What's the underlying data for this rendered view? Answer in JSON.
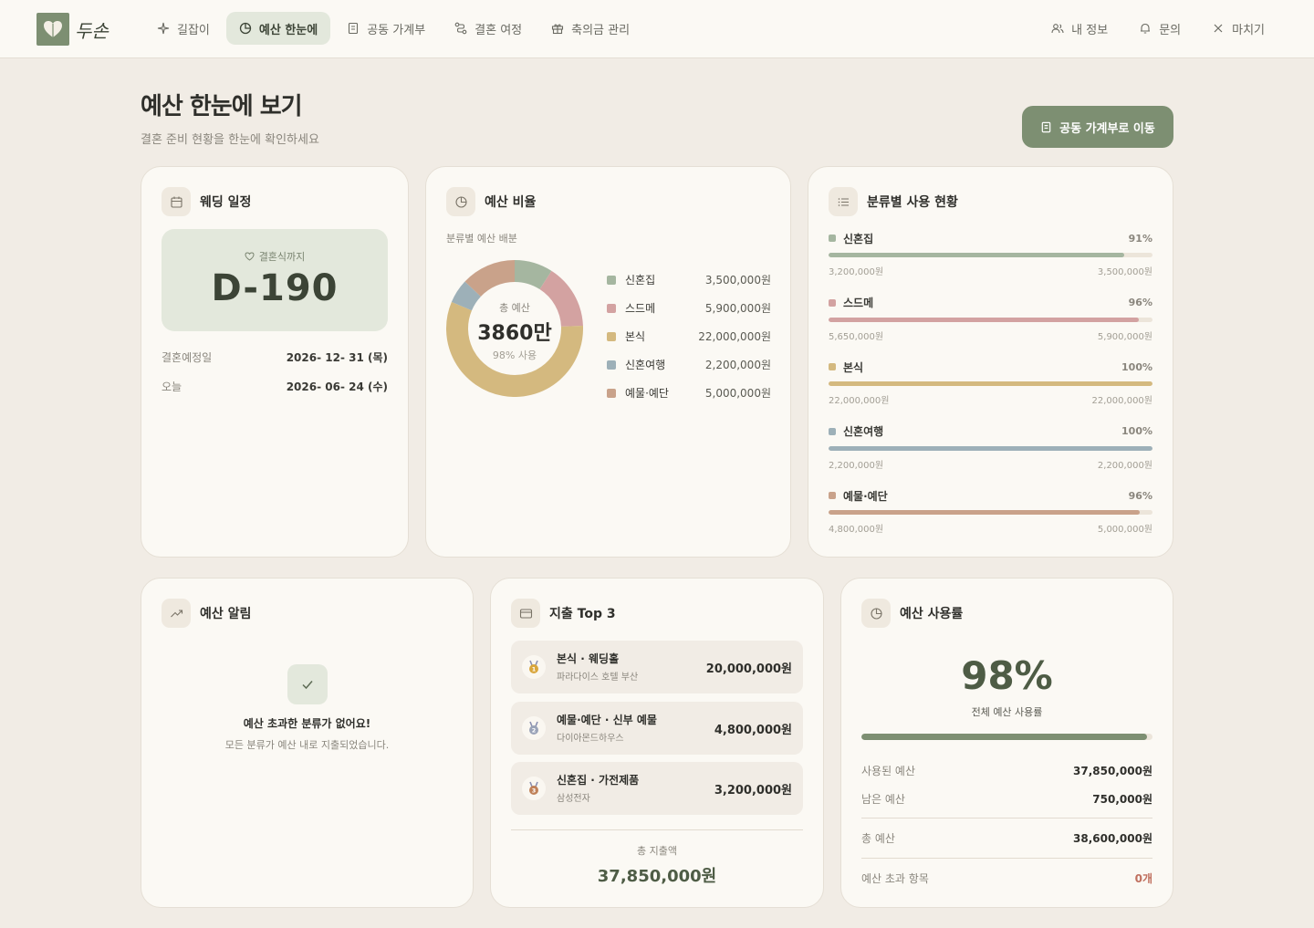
{
  "app": {
    "logo_text": "두손"
  },
  "nav": {
    "items": [
      {
        "label": "길잡이",
        "icon": "sparkle-icon"
      },
      {
        "label": "예산 한눈에",
        "icon": "pie-chart-icon",
        "active": true
      },
      {
        "label": "공동 가계부",
        "icon": "ledger-icon"
      },
      {
        "label": "결혼 여정",
        "icon": "route-icon"
      },
      {
        "label": "축의금 관리",
        "icon": "gift-icon"
      }
    ],
    "right": [
      {
        "label": "내 정보",
        "icon": "users-icon"
      },
      {
        "label": "문의",
        "icon": "bell-icon"
      },
      {
        "label": "마치기",
        "icon": "close-icon"
      }
    ]
  },
  "header": {
    "title": "예산 한눈에 보기",
    "subtitle": "결혼 준비 현황을 한눈에 확인하세요",
    "ledger_button": "공동 가계부로 이동"
  },
  "schedule": {
    "title": "웨딩 일정",
    "until_label": "결혼식까지",
    "dday": "D-190",
    "wedding_date_label": "결혼예정일",
    "wedding_date": "2026- 12- 31 (목)",
    "today_label": "오늘",
    "today": "2026- 06- 24 (수)"
  },
  "ratio": {
    "title": "예산 비율",
    "subtitle": "분류별 예산 배분",
    "total_label": "총 예산",
    "total": "3860만",
    "usage": "98% 사용"
  },
  "chart_data": {
    "type": "pie",
    "categories": [
      "신혼집",
      "스드메",
      "본식",
      "신혼여행",
      "예물·예단"
    ],
    "values": [
      3500000,
      5900000,
      22000000,
      2200000,
      5000000
    ],
    "labels": [
      "3,500,000원",
      "5,900,000원",
      "22,000,000원",
      "2,200,000원",
      "5,000,000원"
    ],
    "colors": [
      "#a5b6a0",
      "#d3a2a1",
      "#d4b97f",
      "#9db0b8",
      "#c9a28a"
    ]
  },
  "category_usage": {
    "title": "분류별 사용 현황",
    "items": [
      {
        "name": "신혼집",
        "pct": "91%",
        "ratio": 0.914,
        "used": "3,200,000원",
        "budget": "3,500,000원",
        "color": "#a5b6a0"
      },
      {
        "name": "스드메",
        "pct": "96%",
        "ratio": 0.958,
        "used": "5,650,000원",
        "budget": "5,900,000원",
        "color": "#d3a2a1"
      },
      {
        "name": "본식",
        "pct": "100%",
        "ratio": 1.0,
        "used": "22,000,000원",
        "budget": "22,000,000원",
        "color": "#d4b97f"
      },
      {
        "name": "신혼여행",
        "pct": "100%",
        "ratio": 1.0,
        "used": "2,200,000원",
        "budget": "2,200,000원",
        "color": "#9db0b8"
      },
      {
        "name": "예물·예단",
        "pct": "96%",
        "ratio": 0.96,
        "used": "4,800,000원",
        "budget": "5,000,000원",
        "color": "#c9a28a"
      }
    ]
  },
  "alert": {
    "title": "예산 알림",
    "message_title": "예산 초과한 분류가 없어요!",
    "message_desc": "모든 분류가 예산 내로 지출되었습니다."
  },
  "top3": {
    "title": "지출 Top 3",
    "items": [
      {
        "rank": "1",
        "name": "본식 · 웨딩홀",
        "vendor": "파라다이스 호텔 부산",
        "amount": "20,000,000원",
        "medal_color": "#d9a63c"
      },
      {
        "rank": "2",
        "name": "예물·예단 · 신부 예물",
        "vendor": "다이아몬드하우스",
        "amount": "4,800,000원",
        "medal_color": "#9aa3b8"
      },
      {
        "rank": "3",
        "name": "신혼집 · 가전제품",
        "vendor": "삼성전자",
        "amount": "3,200,000원",
        "medal_color": "#c08158"
      }
    ],
    "total_label": "총 지출액",
    "total": "37,850,000원"
  },
  "usage_rate": {
    "title": "예산 사용률",
    "pct": "98%",
    "ratio": 0.98,
    "label": "전체 예산 사용률",
    "used_label": "사용된 예산",
    "used": "37,850,000원",
    "remaining_label": "남은 예산",
    "remaining": "750,000원",
    "total_label": "총 예산",
    "total": "38,600,000원",
    "over_label": "예산 초과 항목",
    "over": "0개",
    "over_color": "#c0705f"
  }
}
